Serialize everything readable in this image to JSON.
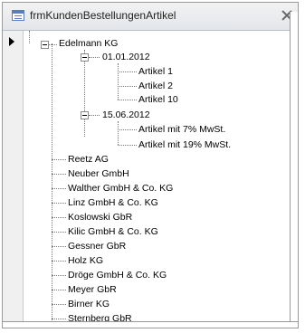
{
  "window": {
    "title": "frmKundenBestellungenArtikel"
  },
  "tree": {
    "root": {
      "label": "Edelmann KG",
      "dates": [
        {
          "label": "01.01.2012",
          "items": [
            "Artikel 1",
            "Artikel 2",
            "Artikel 10"
          ]
        },
        {
          "label": "15.06.2012",
          "items": [
            "Artikel mit 7% MwSt.",
            "Artikel mit 19% MwSt."
          ]
        }
      ]
    },
    "customers": [
      "Reetz AG",
      "Neuber GmbH",
      "Walther GmbH & Co. KG",
      "Linz GmbH & Co. KG",
      "Koslowski GbR",
      "Kilic GmbH & Co. KG",
      "Gessner GbR",
      "Holz KG",
      "Dröge GmbH & Co. KG",
      "Meyer GbR",
      "Birner KG",
      "Sternberg GbR"
    ]
  }
}
